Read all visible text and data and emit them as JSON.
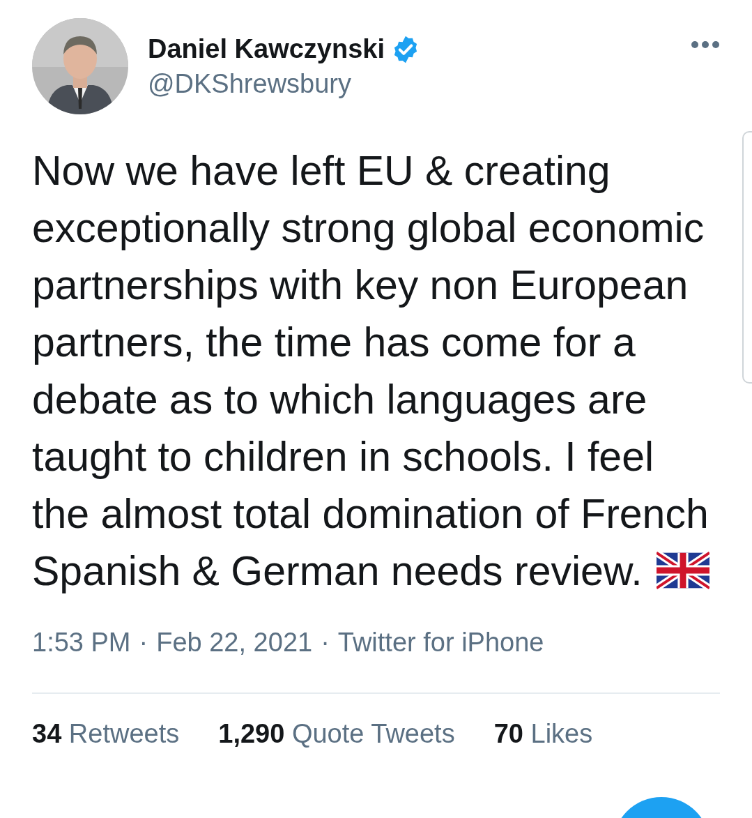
{
  "author": {
    "name": "Daniel Kawczynski",
    "verified": true,
    "handle": "@DKShrewsbury"
  },
  "tweet": {
    "text": "Now we have left EU & creating exceptionally strong global economic partnerships with key non European partners, the time has come for a debate as to which languages are taught to children in schools. I feel the almost total domination of French Spanish & German needs review."
  },
  "meta": {
    "time": "1:53 PM",
    "separator": "·",
    "date": "Feb 22, 2021",
    "source": "Twitter for iPhone"
  },
  "stats": [
    {
      "count": "34",
      "label": "Retweets"
    },
    {
      "count": "1,290",
      "label": "Quote Tweets"
    },
    {
      "count": "70",
      "label": "Likes"
    }
  ]
}
